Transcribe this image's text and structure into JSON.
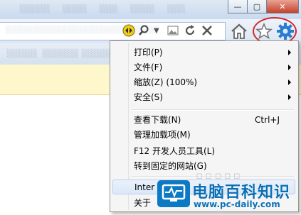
{
  "menu": {
    "items": [
      {
        "label": "打印(P)",
        "submenu": true
      },
      {
        "label": "文件(F)",
        "submenu": true
      },
      {
        "label": "缩放(Z) (100%)",
        "submenu": true
      },
      {
        "label": "安全(S)",
        "submenu": true
      },
      {
        "label": "查看下载(N)",
        "shortcut": "Ctrl+J"
      },
      {
        "label": "管理加载项(M)"
      },
      {
        "label": "F12 开发人员工具(L)"
      },
      {
        "label": "转到固定的网站(G)"
      },
      {
        "label": "Inter"
      },
      {
        "label": "关于"
      }
    ]
  },
  "watermark": {
    "title": "电脑百科知识",
    "url": "www.pc-daily.com"
  },
  "colors": {
    "annotation": "#d6282b",
    "brand_blue": "#0b6fb6",
    "infobar": "#fff7cc",
    "menu_highlight": "#dbe8f8"
  },
  "icons": [
    "compat-view-icon",
    "search-icon",
    "dropdown-icon",
    "image-icon",
    "refresh-icon",
    "stop-icon",
    "home-icon",
    "favorites-star-icon",
    "tools-gear-icon",
    "minimize-icon",
    "maximize-icon",
    "close-icon",
    "monitor-logo-icon"
  ]
}
